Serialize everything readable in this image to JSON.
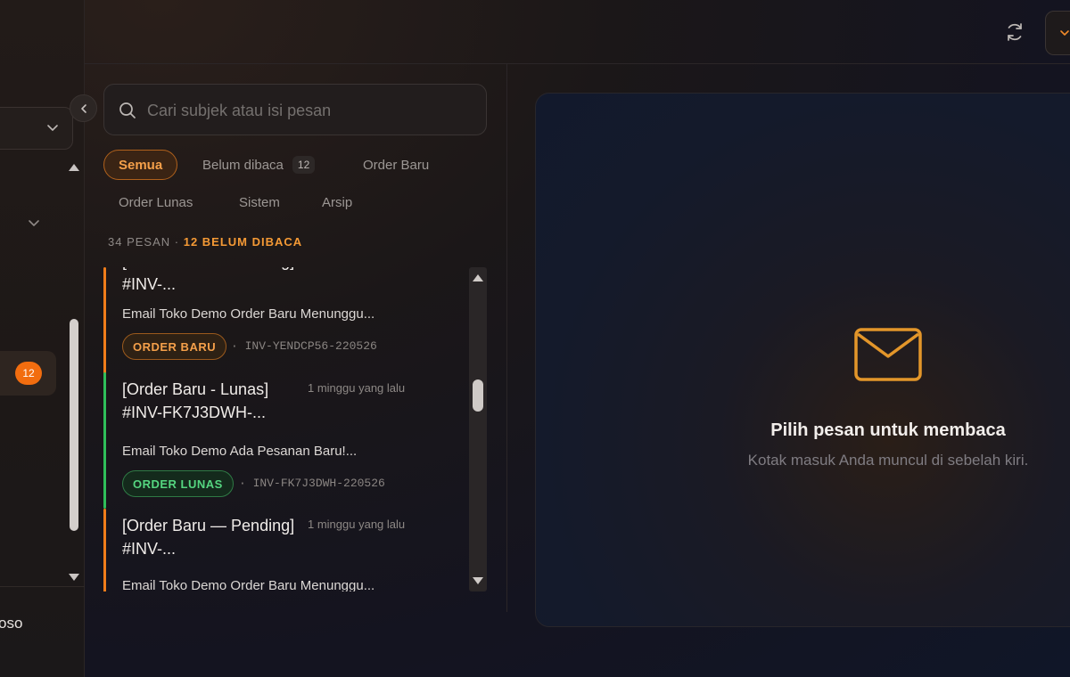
{
  "sidebar": {
    "badge_count": "12",
    "user_name_fragment": "oso"
  },
  "search": {
    "placeholder": "Cari subjek atau isi pesan"
  },
  "filters": [
    {
      "label": "Semua",
      "count": null
    },
    {
      "label": "Belum dibaca",
      "count": "12"
    },
    {
      "label": "Order Baru",
      "count": null
    },
    {
      "label": "Order Lunas",
      "count": null
    },
    {
      "label": "Sistem",
      "count": null
    },
    {
      "label": "Arsip",
      "count": null
    }
  ],
  "summary": {
    "total": "34 PESAN",
    "separator": " · ",
    "unread": "12 BELUM DIBACA"
  },
  "messages": [
    {
      "subject": "[Order Baru — Pending] #INV-...",
      "time": "",
      "preview": "Email Toko Demo Order Baru Menunggu...",
      "tag": "ORDER BARU",
      "invoice": "INV-YENDCP56-220526",
      "accent": "#f07d1a"
    },
    {
      "subject": "[Order Baru - Lunas] #INV-FK7J3DWH-...",
      "time": "1 minggu yang lalu",
      "preview": "Email Toko Demo Ada Pesanan Baru!...",
      "tag": "ORDER LUNAS",
      "invoice": "INV-FK7J3DWH-220526",
      "accent": "#2fbf5a"
    },
    {
      "subject": "[Order Baru — Pending] #INV-...",
      "time": "1 minggu yang lalu",
      "preview": "Email Toko Demo Order Baru Menunggu...",
      "tag": "",
      "invoice": "",
      "accent": "#f07d1a"
    }
  ],
  "reader": {
    "empty_title": "Pilih pesan untuk membaca",
    "empty_subtitle": "Kotak masuk Anda muncul di sebelah kiri."
  },
  "icons": {
    "refresh": "refresh-icon",
    "search": "search-icon",
    "envelope": "envelope-icon",
    "collapse": "chevron-left-icon"
  },
  "colors": {
    "accent": "#f59a35",
    "badge": "#f26d0f",
    "lunas": "#55d680"
  }
}
